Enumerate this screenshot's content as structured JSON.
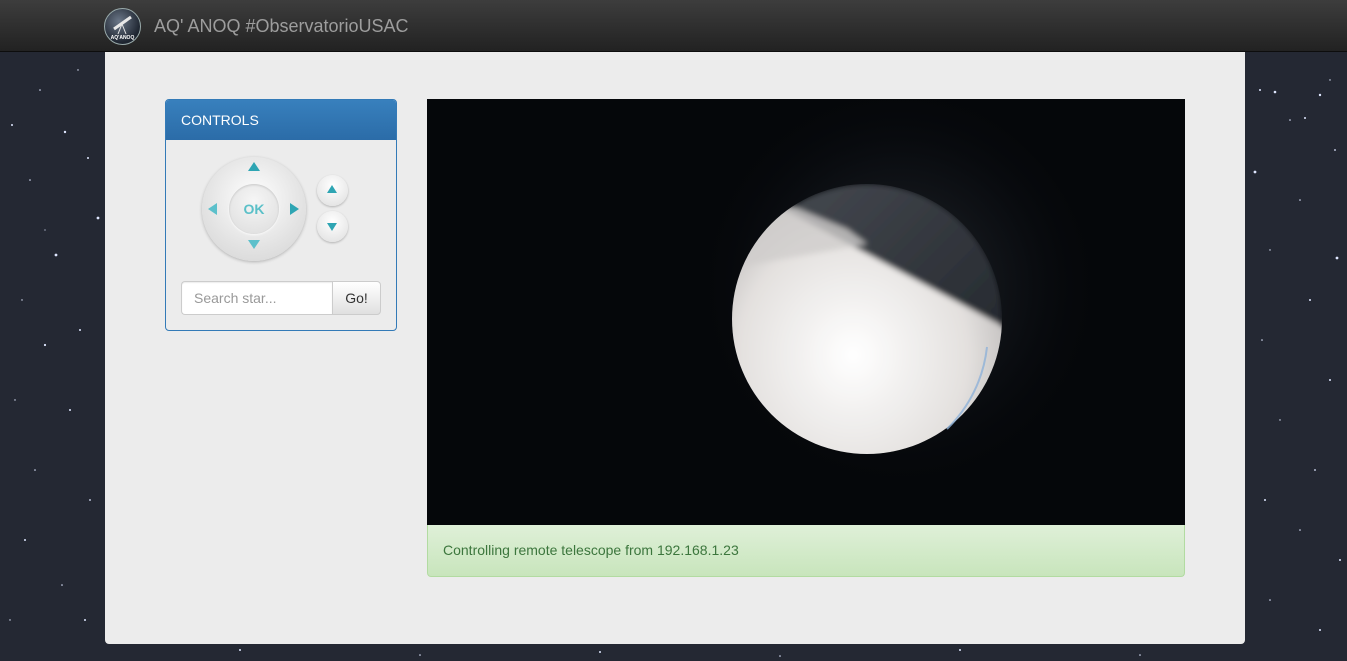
{
  "app": {
    "brand_title": "AQ' ANOQ #ObservatorioUSAC",
    "logo_text": "AQ'ANOQ"
  },
  "controls": {
    "heading": "CONTROLS",
    "ok_label": "OK",
    "search": {
      "placeholder": "Search star...",
      "value": ""
    },
    "go_label": "Go!"
  },
  "viewer": {
    "status_message": "Controlling remote telescope from 192.168.1.23"
  },
  "colors": {
    "navbar": "#222222",
    "panel_primary": "#337ab7",
    "accent_arrows": "#2ea5b3",
    "success_bg": "#dff0d8",
    "success_text": "#3c763d",
    "space_background": "#242833"
  }
}
